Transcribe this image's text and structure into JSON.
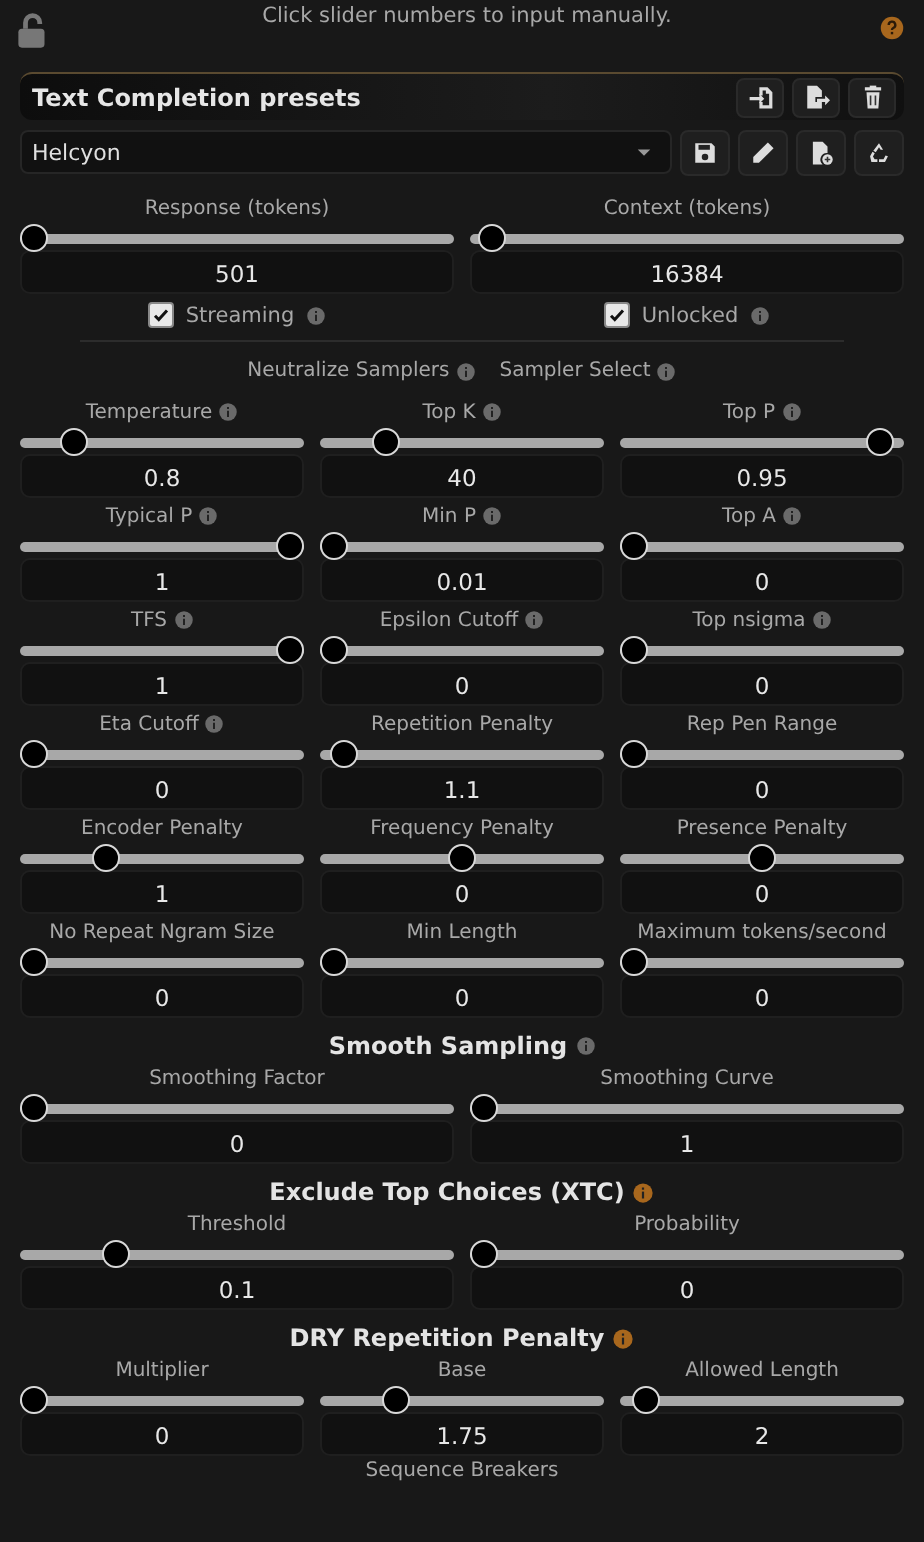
{
  "hint": "Click slider numbers to input manually.",
  "presets": {
    "title": "Text Completion presets",
    "selected_preset": "Helcyon"
  },
  "token_sliders": [
    {
      "label": "Response (tokens)",
      "level": 0.0,
      "value": "501"
    },
    {
      "label": "Context (tokens)",
      "level": 0.02,
      "value": "16384"
    }
  ],
  "checkboxes": [
    {
      "label": "Streaming",
      "checked": true
    },
    {
      "label": "Unlocked",
      "checked": true
    }
  ],
  "sampler_buttons": [
    {
      "label": "Neutralize Samplers"
    },
    {
      "label": "Sampler Select"
    }
  ],
  "samplers": [
    {
      "label": "Temperature",
      "info": true,
      "level": 0.16,
      "value": "0.8"
    },
    {
      "label": "Top K",
      "info": true,
      "level": 0.2,
      "value": "40"
    },
    {
      "label": "Top P",
      "info": true,
      "level": 0.96,
      "value": "0.95"
    },
    {
      "label": "Typical P",
      "info": true,
      "level": 1,
      "value": "1"
    },
    {
      "label": "Min P",
      "info": true,
      "level": 0.0,
      "value": "0.01"
    },
    {
      "label": "Top A",
      "info": true,
      "level": 0,
      "value": "0"
    },
    {
      "label": "TFS",
      "info": true,
      "level": 1,
      "value": "1"
    },
    {
      "label": "Epsilon Cutoff",
      "info": true,
      "level": 0,
      "value": "0"
    },
    {
      "label": "Top nsigma",
      "info": true,
      "level": 0,
      "value": "0"
    },
    {
      "label": "Eta Cutoff",
      "info": true,
      "level": 0,
      "value": "0"
    },
    {
      "label": "Repetition Penalty",
      "info": false,
      "level": 0.04,
      "value": "1.1"
    },
    {
      "label": "Rep Pen Range",
      "info": false,
      "level": 0,
      "value": "0"
    },
    {
      "label": "Encoder Penalty",
      "info": false,
      "level": 0.28,
      "value": "1"
    },
    {
      "label": "Frequency Penalty",
      "info": false,
      "level": 0.5,
      "value": "0"
    },
    {
      "label": "Presence Penalty",
      "info": false,
      "level": 0.5,
      "value": "0"
    },
    {
      "label": "No Repeat Ngram Size",
      "info": false,
      "level": 0,
      "value": "0"
    },
    {
      "label": "Min Length",
      "info": false,
      "level": 0,
      "value": "0"
    },
    {
      "label": "Maximum tokens/second",
      "info": false,
      "level": 0,
      "value": "0"
    }
  ],
  "sections": [
    {
      "title": "Smooth Sampling",
      "info_accent": false,
      "sliders": [
        {
          "label": "Smoothing Factor",
          "level": 0,
          "value": "0"
        },
        {
          "label": "Smoothing Curve",
          "level": 0,
          "value": "1"
        }
      ]
    },
    {
      "title": "Exclude Top Choices (XTC)",
      "info_accent": true,
      "sliders": [
        {
          "label": "Threshold",
          "level": 0.2,
          "value": "0.1"
        },
        {
          "label": "Probability",
          "level": 0,
          "value": "0"
        }
      ]
    },
    {
      "title": "DRY Repetition Penalty",
      "info_accent": true,
      "sliders": [
        {
          "label": "Multiplier",
          "level": 0,
          "value": "0"
        },
        {
          "label": "Base",
          "level": 0.24,
          "value": "1.75"
        },
        {
          "label": "Allowed Length",
          "level": 0.05,
          "value": "2"
        }
      ]
    }
  ],
  "footer_label": "Sequence Breakers"
}
